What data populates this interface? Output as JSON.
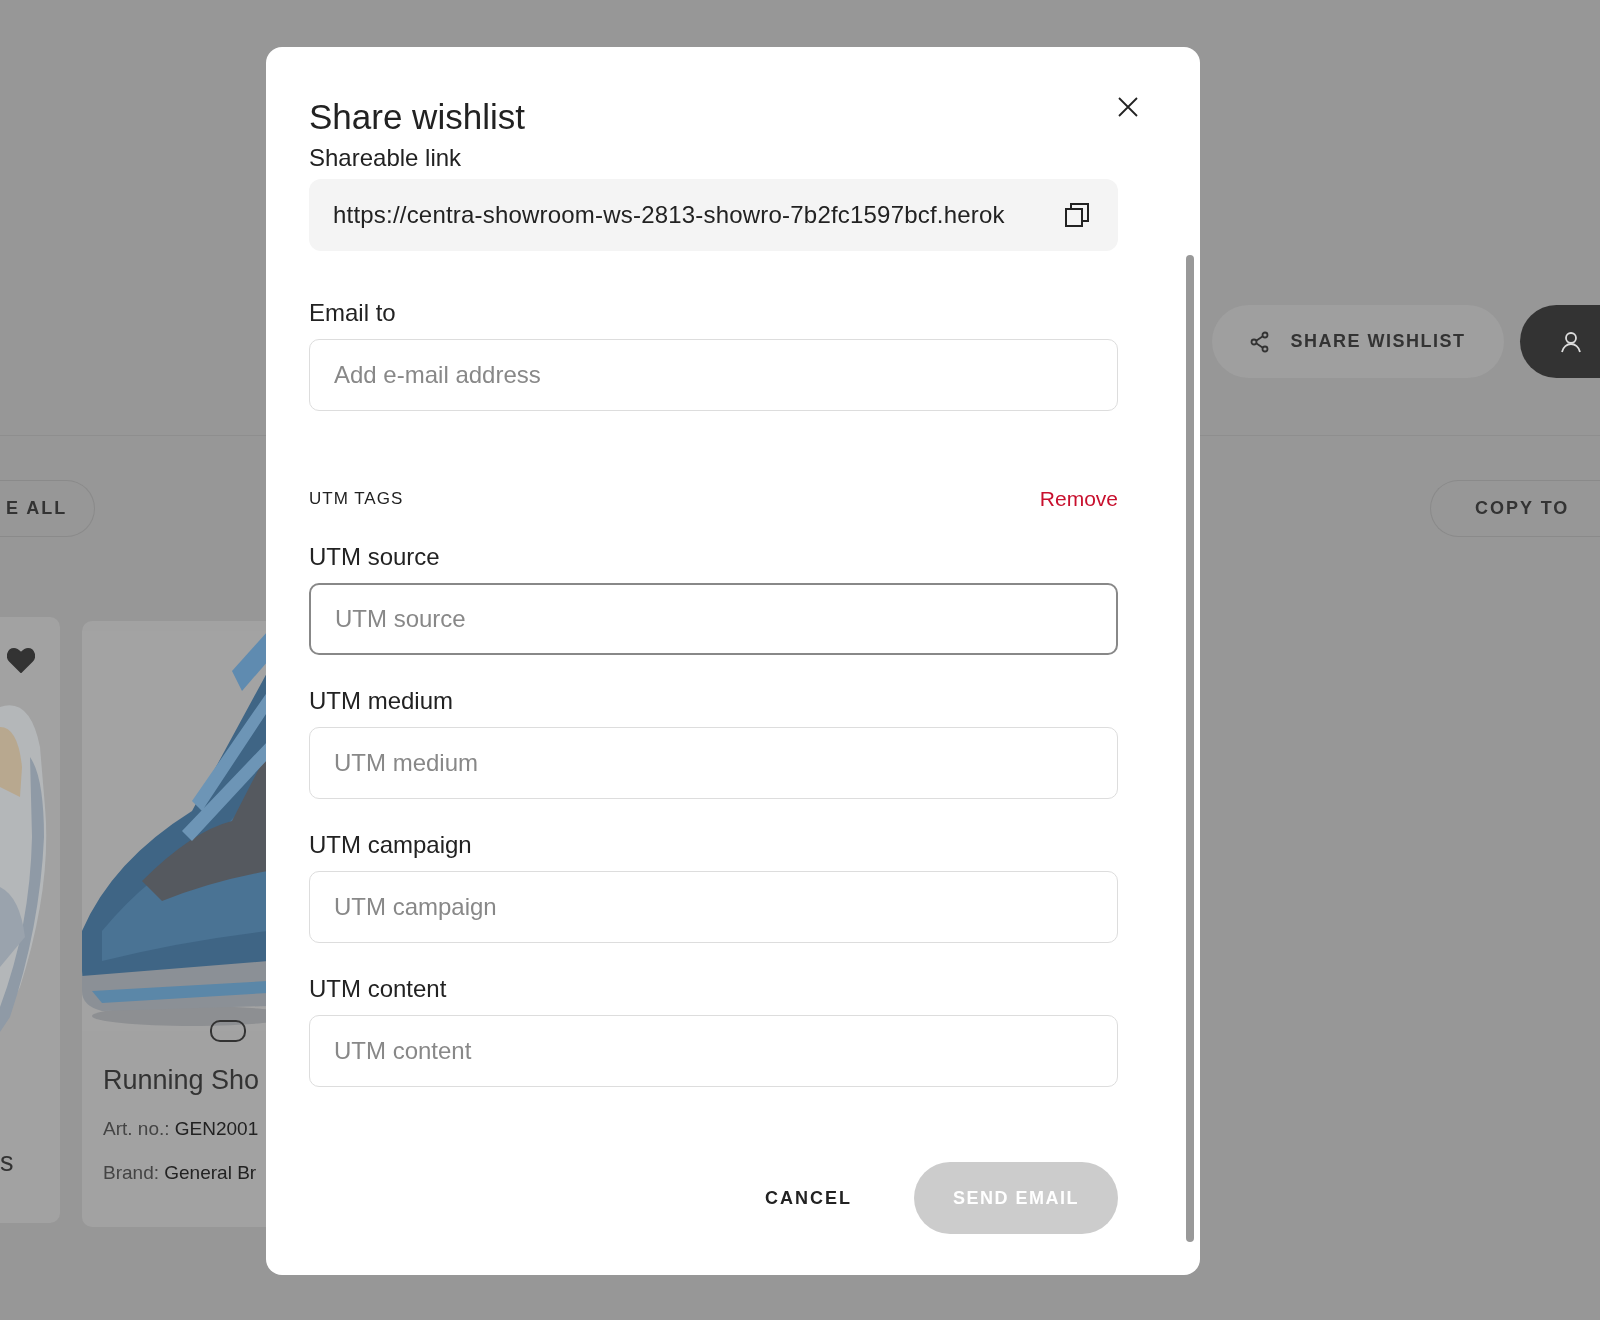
{
  "background": {
    "share_button": "SHARE WISHLIST",
    "toolbar_left": "E ALL",
    "toolbar_right": "COPY TO",
    "cards": [
      {
        "title": "s",
        "favorite": true
      },
      {
        "title": "Running Sho",
        "art_label": "Art. no.:",
        "art_value": "GEN2001",
        "brand_label": "Brand:",
        "brand_value": "General Br"
      }
    ]
  },
  "dialog": {
    "title": "Share wishlist",
    "link_label": "Shareable link",
    "link": "https://centra-showroom-ws-2813-showro-7b2fc1597bcf.herok",
    "email_label": "Email to",
    "email_placeholder": "Add e-mail address",
    "utm_heading": "UTM TAGS",
    "remove": "Remove",
    "utm_fields": [
      {
        "label": "UTM source",
        "placeholder": "UTM source",
        "focused": true
      },
      {
        "label": "UTM medium",
        "placeholder": "UTM medium",
        "focused": false
      },
      {
        "label": "UTM campaign",
        "placeholder": "UTM campaign",
        "focused": false
      },
      {
        "label": "UTM content",
        "placeholder": "UTM content",
        "focused": false
      }
    ],
    "cancel": "CANCEL",
    "send": {
      "label": "SEND EMAIL",
      "disabled": true
    }
  }
}
